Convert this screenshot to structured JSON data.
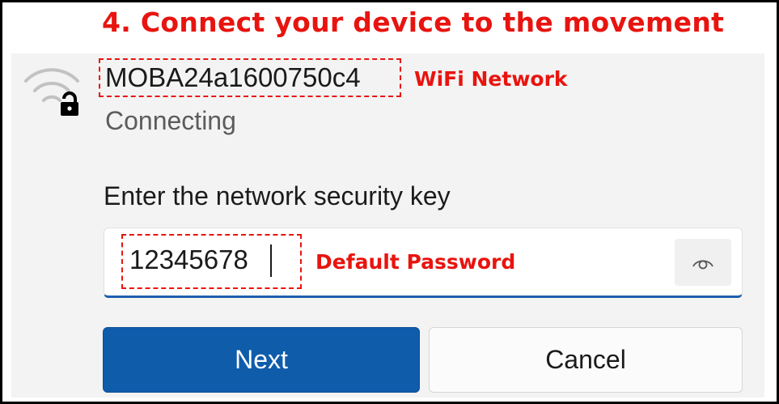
{
  "heading": "4. Connect your device to the movement",
  "network": {
    "ssid": "MOBA24a1600750c4",
    "ssid_note": "WiFi Network",
    "status": "Connecting"
  },
  "password": {
    "prompt": "Enter the network security key",
    "value": "12345678",
    "value_note": "Default Password"
  },
  "buttons": {
    "next": "Next",
    "cancel": "Cancel"
  },
  "icons": {
    "network": "wifi-secured-icon",
    "reveal": "eye-icon"
  },
  "colors": {
    "annotation": "#e8140f",
    "accent": "#0f5cab"
  }
}
